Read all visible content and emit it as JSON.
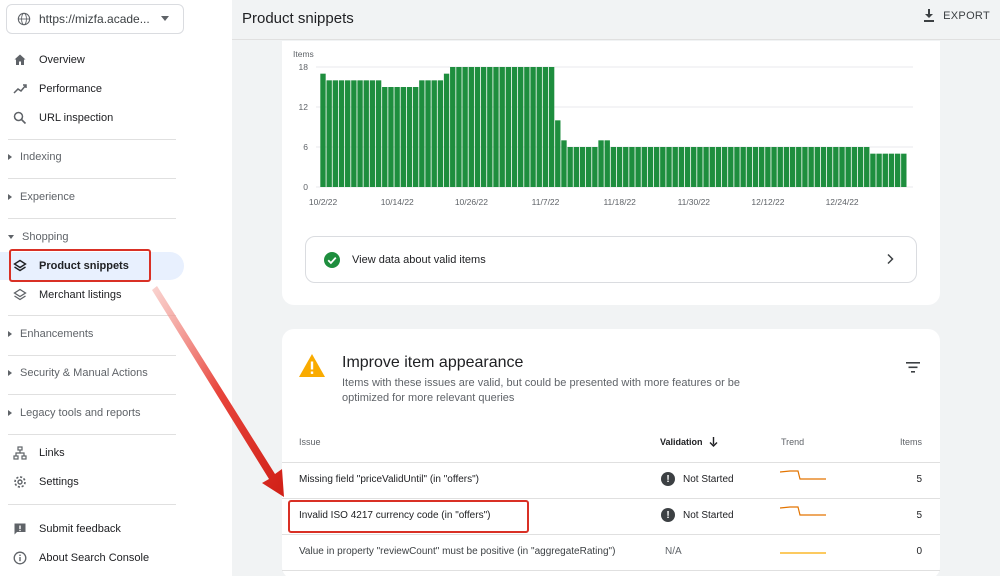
{
  "property": {
    "url": "https://mizfa.acade..."
  },
  "sidebar": {
    "items": {
      "overview": "Overview",
      "performance": "Performance",
      "url_inspection": "URL inspection",
      "indexing": "Indexing",
      "experience": "Experience",
      "shopping": "Shopping",
      "product_snippets": "Product snippets",
      "merchant_listings": "Merchant listings",
      "enhancements": "Enhancements",
      "security": "Security & Manual Actions",
      "legacy": "Legacy tools and reports",
      "links": "Links",
      "settings": "Settings",
      "feedback": "Submit feedback",
      "about": "About Search Console"
    }
  },
  "header": {
    "title": "Product snippets",
    "export_label": "EXPORT"
  },
  "chart_data": {
    "type": "bar",
    "ylabel": "Items",
    "ylim": [
      0,
      18
    ],
    "yticks": [
      "18",
      "12",
      "6",
      "0"
    ],
    "xtick_labels": [
      "10/2/22",
      "10/14/22",
      "10/26/22",
      "11/7/22",
      "11/18/22",
      "11/30/22",
      "12/12/22",
      "12/24/22"
    ],
    "color": "#1e8e3e",
    "values": [
      17,
      16,
      16,
      16,
      16,
      16,
      16,
      16,
      16,
      16,
      15,
      15,
      15,
      15,
      15,
      15,
      16,
      16,
      16,
      16,
      17,
      18,
      18,
      18,
      18,
      18,
      18,
      18,
      18,
      18,
      18,
      18,
      18,
      18,
      18,
      18,
      18,
      18,
      10,
      7,
      6,
      6,
      6,
      6,
      6,
      7,
      7,
      6,
      6,
      6,
      6,
      6,
      6,
      6,
      6,
      6,
      6,
      6,
      6,
      6,
      6,
      6,
      6,
      6,
      6,
      6,
      6,
      6,
      6,
      6,
      6,
      6,
      6,
      6,
      6,
      6,
      6,
      6,
      6,
      6,
      6,
      6,
      6,
      6,
      6,
      6,
      6,
      6,
      6,
      5,
      5,
      5,
      5,
      5,
      5
    ]
  },
  "valid_items": {
    "label": "View data about valid items"
  },
  "issues": {
    "title": "Improve item appearance",
    "description": "Items with these issues are valid, but could be presented with more features or be optimized for more relevant queries",
    "columns": {
      "issue": "Issue",
      "validation": "Validation",
      "trend": "Trend",
      "items": "Items"
    },
    "rows": [
      {
        "issue": "Missing field \"priceValidUntil\" (in \"offers\")",
        "status": "Not Started",
        "items": "5",
        "trend_color": "#e37400"
      },
      {
        "issue": "Invalid ISO 4217 currency code (in \"offers\")",
        "status": "Not Started",
        "items": "5",
        "trend_color": "#e37400"
      },
      {
        "issue": "Value in property \"reviewCount\" must be positive (in \"aggregateRating\")",
        "status": "N/A",
        "items": "0",
        "trend_color": "#f9ab00"
      }
    ]
  },
  "colors": {
    "accent_red": "#d93025",
    "active_bg": "#e8f0fe",
    "bar_green": "#1e8e3e",
    "warning_yellow": "#f9ab00"
  }
}
